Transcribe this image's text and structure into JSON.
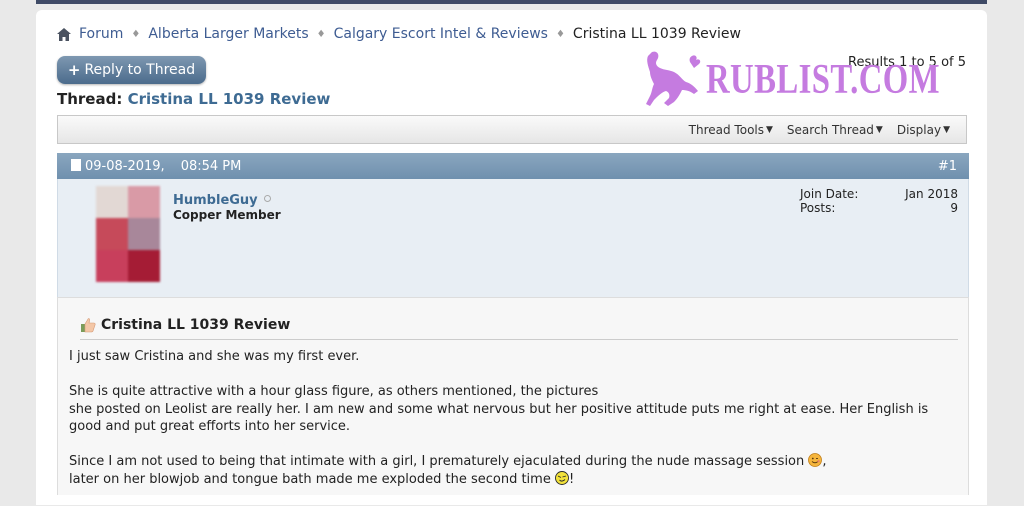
{
  "breadcrumb": {
    "items": [
      "Forum",
      "Alberta Larger Markets",
      "Calgary Escort Intel & Reviews"
    ],
    "current": "Cristina LL 1039 Review"
  },
  "toolbar": {
    "reply_label": "Reply to Thread",
    "results": "Results 1 to 5 of 5"
  },
  "watermark": {
    "text": "RUBLIST.COM"
  },
  "thread": {
    "label": "Thread:",
    "title": "Cristina LL 1039 Review"
  },
  "thread_controls": [
    "Thread Tools",
    "Search Thread",
    "Display"
  ],
  "post": {
    "date": "09-08-2019,",
    "time": "08:54 PM",
    "number": "#1",
    "user": {
      "name": "HumbleGuy",
      "title": "Copper Member",
      "stats": [
        {
          "label": "Join Date:",
          "value": "Jan 2018"
        },
        {
          "label": "Posts:",
          "value": "9"
        }
      ]
    },
    "title": "Cristina LL 1039 Review",
    "body": {
      "p1": "I just saw Cristina and she was my first ever.",
      "p2_line1": "She is quite attractive with a hour glass figure, as others mentioned, the pictures",
      "p2_line2": "she posted on Leolist are really her. I am new and some what nervous but her positive attitude puts me right at ease. Her English is good and put great efforts into her service.",
      "p3_line1": "Since I am not used to being that intimate with a girl, I prematurely ejaculated during the nude massage session",
      "p3_line1_end": ",",
      "p3_line2": "later on her blowjob and tongue bath made me exploded the second time",
      "p3_line2_end": "!"
    }
  },
  "icons": {
    "home": "home-icon",
    "separator": "diamond-separator-icon",
    "thumb": "thumbs-up-icon",
    "smiley_wink": "wink-smiley-icon",
    "smiley_drool": "drool-smiley-icon"
  },
  "colors": {
    "link": "#3e5c92",
    "post_header": "#7d9bb8",
    "watermark": "#c57be0"
  }
}
